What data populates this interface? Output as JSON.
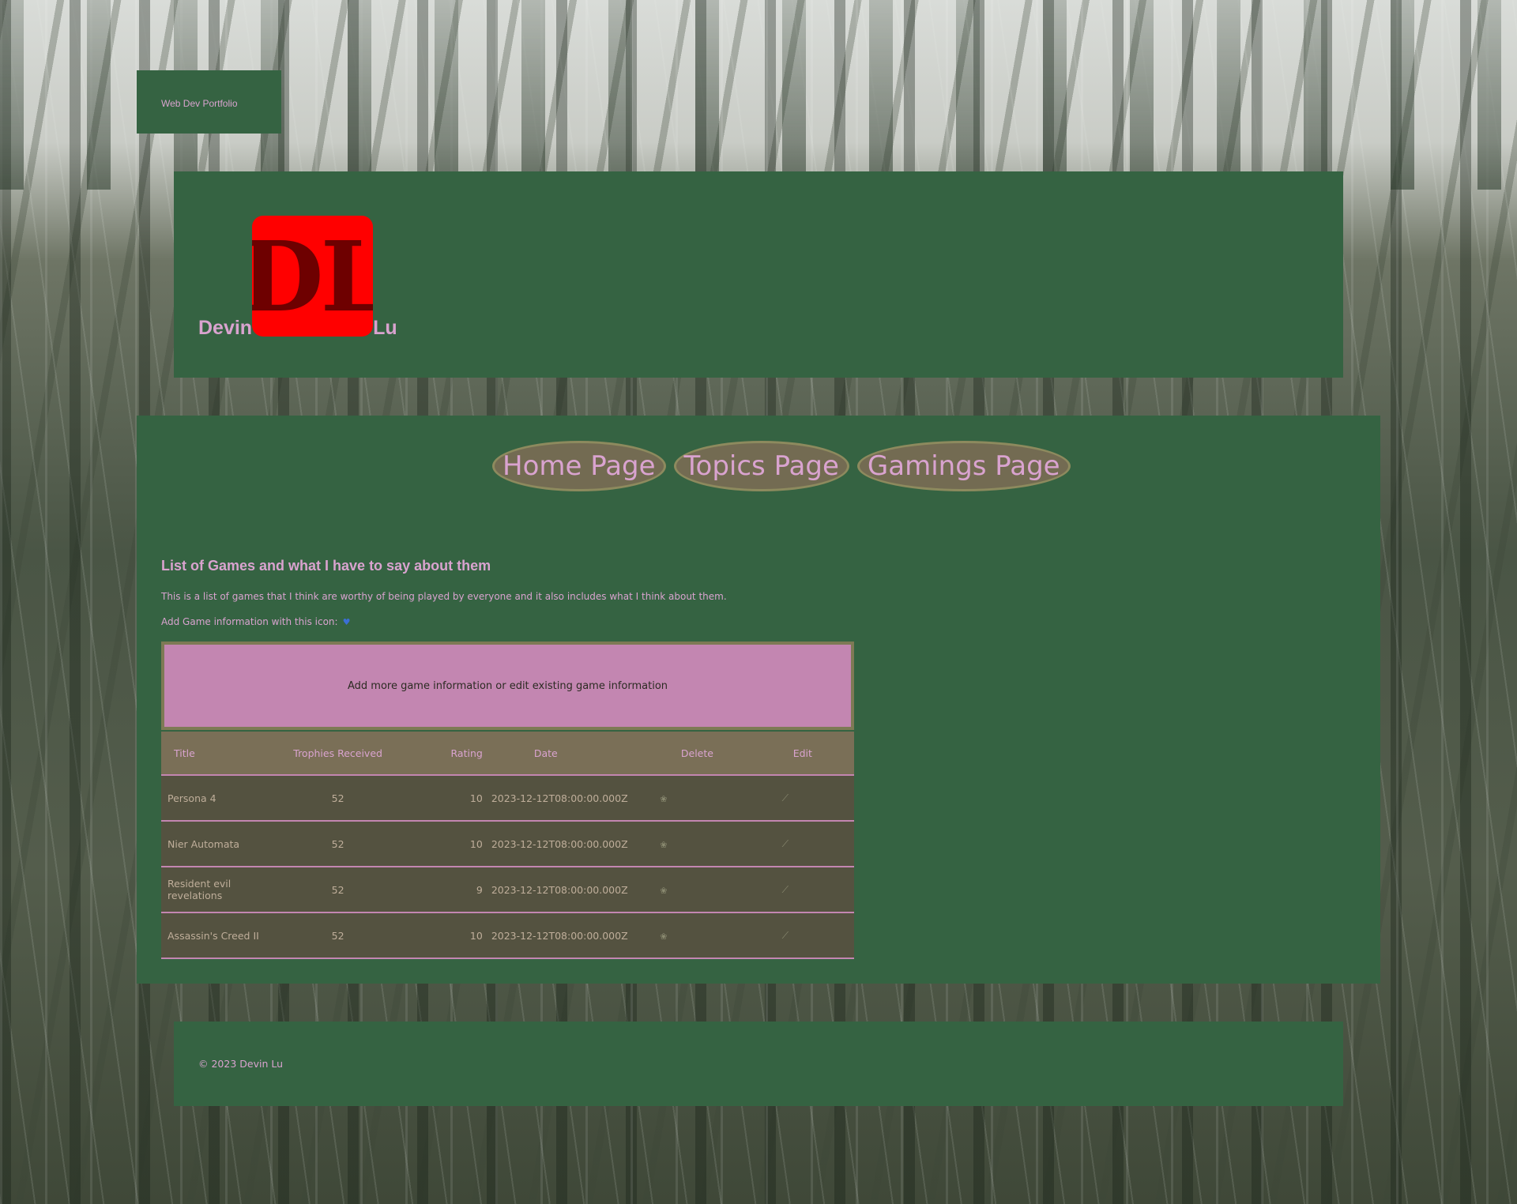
{
  "badge": {
    "label": "Web Dev Portfolio"
  },
  "header": {
    "first_name": "Devin",
    "logo_text": "DL",
    "last_name": "Lu"
  },
  "nav": {
    "items": [
      {
        "label": "Home Page"
      },
      {
        "label": "Topics Page"
      },
      {
        "label": "Gamings Page"
      }
    ]
  },
  "main": {
    "title": "List of Games and what I have to say about them",
    "intro": "This is a list of games that I think are worthy of being played by everyone and it also includes what I think about them.",
    "add_line": "Add Game information with this icon:",
    "add_panel": "Add more game information or edit existing game information"
  },
  "table": {
    "headers": {
      "title": "Title",
      "trophies": "Trophies Received",
      "rating": "Rating",
      "date": "Date",
      "delete": "Delete",
      "edit": "Edit"
    },
    "rows": [
      {
        "title": "Persona 4",
        "trophies": "52",
        "rating": "10",
        "date": "2023-12-12T08:00:00.000Z"
      },
      {
        "title": "Nier Automata",
        "trophies": "52",
        "rating": "10",
        "date": "2023-12-12T08:00:00.000Z"
      },
      {
        "title": "Resident evil revelations",
        "trophies": "52",
        "rating": "9",
        "date": "2023-12-12T08:00:00.000Z"
      },
      {
        "title": "Assassin's Creed II",
        "trophies": "52",
        "rating": "10",
        "date": "2023-12-12T08:00:00.000Z"
      }
    ],
    "delete_icon": "trash-icon",
    "edit_icon": "pencil-icon"
  },
  "footer": {
    "text": "© 2023 Devin Lu"
  },
  "colors": {
    "panel": "#356342",
    "accent_text": "#d9a3cf",
    "logo_bg": "#ff0000",
    "add_panel": "#c386b1",
    "nav_button": "#736b52"
  }
}
